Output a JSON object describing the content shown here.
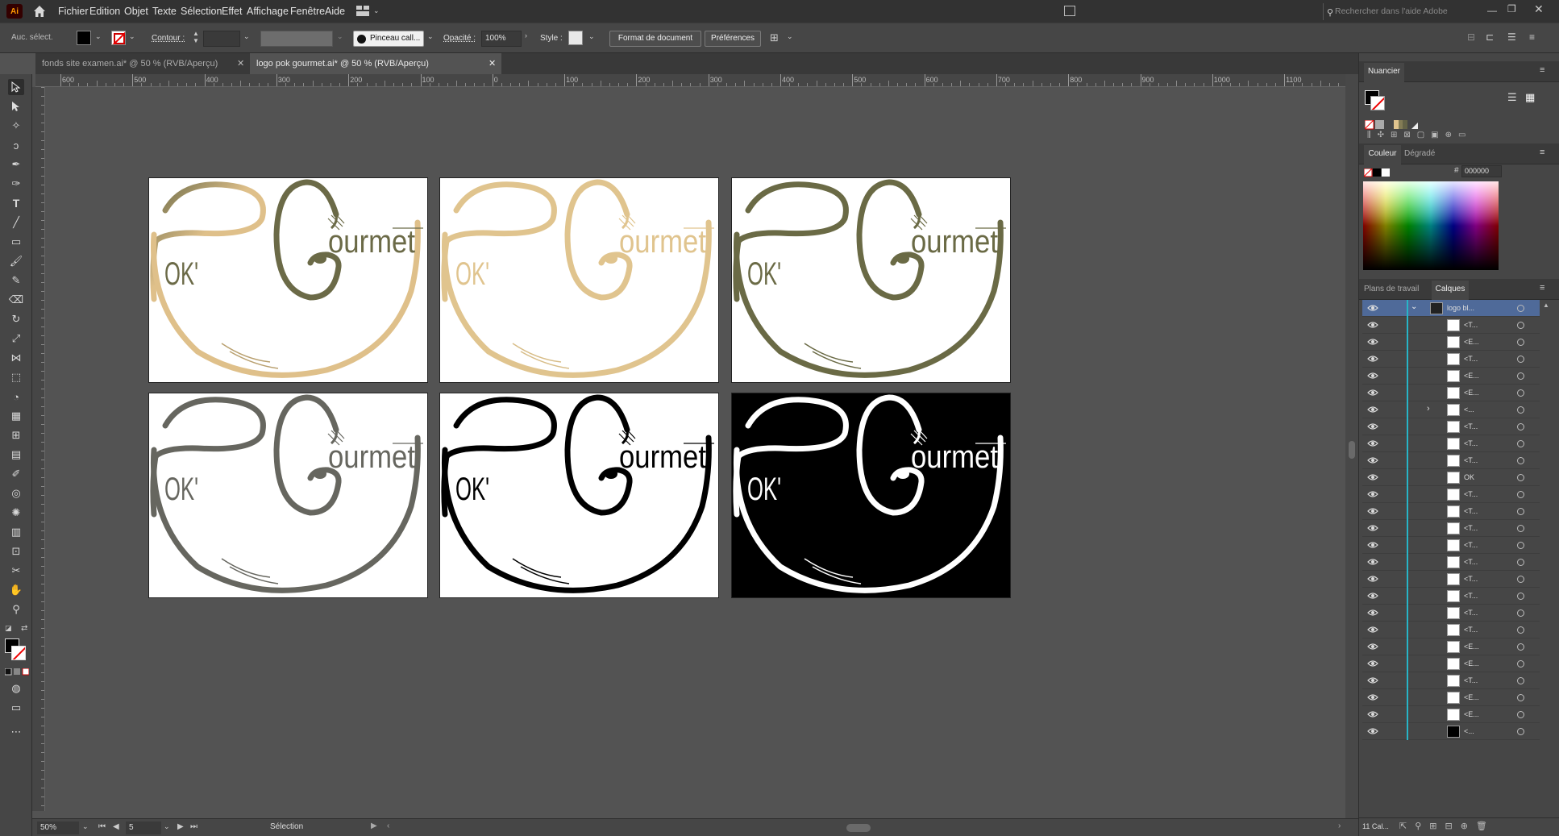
{
  "app": {
    "logo_text": "Ai"
  },
  "menus": [
    "Fichier",
    "Edition",
    "Objet",
    "Texte",
    "Sélection",
    "Effet",
    "Affichage",
    "Fenêtre",
    "Aide"
  ],
  "search": {
    "placeholder": "Rechercher dans l'aide Adobe"
  },
  "control_bar": {
    "selection_label": "Auc. sélect.",
    "stroke_label": "Contour :",
    "brush_label": "Pinceau call...",
    "opacity_label": "Opacité :",
    "opacity_value": "100%",
    "style_label": "Style :",
    "doc_format_button": "Format de document",
    "preferences_button": "Préférences"
  },
  "tabs": [
    {
      "label": "fonds site examen.ai* @ 50 % (RVB/Aperçu)",
      "active": false
    },
    {
      "label": "logo pok gourmet.ai* @ 50 % (RVB/Aperçu)",
      "active": true
    }
  ],
  "ruler": {
    "h_labels": [
      "600",
      "500",
      "400",
      "300",
      "200",
      "100",
      "0",
      "100",
      "200",
      "300",
      "400",
      "500",
      "600",
      "700",
      "800",
      "900",
      "1000",
      "1100"
    ]
  },
  "status": {
    "zoom": "50%",
    "artboard_number": "5",
    "tool_name": "Sélection"
  },
  "logo": {
    "brand_text": "ourmet",
    "ok_text": "OK'"
  },
  "artboards": [
    {
      "bg": "#ffffff",
      "colors": [
        "#6b6a47",
        "#dfc08a",
        "#6b6a47"
      ],
      "stroke": "#dfc08a",
      "text": "#6b6a47",
      "lines": "#b9a06f"
    },
    {
      "bg": "#ffffff",
      "colors": [
        "#e0c48e",
        "#e0c48e",
        "#e0c48e"
      ],
      "stroke": "#e0c48e",
      "text": "#e0c48e",
      "lines": "#d8bd88"
    },
    {
      "bg": "#ffffff",
      "colors": [
        "#6a6a45",
        "#6a6a45",
        "#6a6a45"
      ],
      "stroke": "#6a6a45",
      "text": "#6a6a45",
      "lines": "#6a6a45"
    },
    {
      "bg": "#ffffff",
      "colors": [
        "#66665f",
        "#66665f",
        "#66665f"
      ],
      "stroke": "#66665f",
      "text": "#66665f",
      "lines": "#66665f"
    },
    {
      "bg": "#ffffff",
      "colors": [
        "#000000",
        "#000000",
        "#000000"
      ],
      "stroke": "#000000",
      "text": "#000000",
      "lines": "#000000"
    },
    {
      "bg": "#000000",
      "colors": [
        "#ffffff",
        "#ffffff",
        "#ffffff"
      ],
      "stroke": "#ffffff",
      "text": "#ffffff",
      "lines": "#ffffff"
    }
  ],
  "panels": {
    "swatches_title": "Nuancier",
    "color_title": "Couleur",
    "gradient_tab": "Dégradé",
    "hex_value": "000000",
    "artboards_tab": "Plans de travail",
    "layers_tab": "Calques",
    "layers_count": "11 Cal..."
  },
  "layers": [
    {
      "name": "logo bl...",
      "kind": "layer"
    },
    {
      "name": "<T...",
      "kind": "item"
    },
    {
      "name": "<E...",
      "kind": "item"
    },
    {
      "name": "<T...",
      "kind": "item"
    },
    {
      "name": "<E...",
      "kind": "item"
    },
    {
      "name": "<E...",
      "kind": "item"
    },
    {
      "name": "<...",
      "kind": "group"
    },
    {
      "name": "<T...",
      "kind": "item"
    },
    {
      "name": "<T...",
      "kind": "item"
    },
    {
      "name": "<T...",
      "kind": "item"
    },
    {
      "name": "OK",
      "kind": "item"
    },
    {
      "name": "<T...",
      "kind": "item"
    },
    {
      "name": "<T...",
      "kind": "item"
    },
    {
      "name": "<T...",
      "kind": "item"
    },
    {
      "name": "<T...",
      "kind": "item"
    },
    {
      "name": "<T...",
      "kind": "item"
    },
    {
      "name": "<T...",
      "kind": "item"
    },
    {
      "name": "<T...",
      "kind": "item"
    },
    {
      "name": "<T...",
      "kind": "item"
    },
    {
      "name": "<T...",
      "kind": "item"
    },
    {
      "name": "<E...",
      "kind": "item"
    },
    {
      "name": "<E...",
      "kind": "item"
    },
    {
      "name": "<T...",
      "kind": "item"
    },
    {
      "name": "<E...",
      "kind": "item"
    },
    {
      "name": "<E...",
      "kind": "item"
    },
    {
      "name": "<...",
      "kind": "item"
    }
  ]
}
